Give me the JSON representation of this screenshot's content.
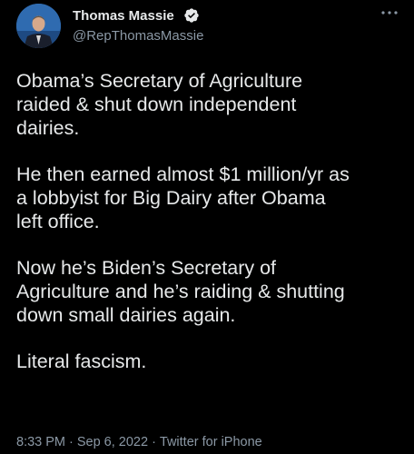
{
  "tweet": {
    "author": {
      "name": "Thomas Massie",
      "handle": "@RepThomasMassie",
      "verified": true,
      "avatar_icon": "profile-photo"
    },
    "menu_icon": "more-dots-icon",
    "paragraphs": [
      "Obama’s Secretary of Agriculture\nraided & shut down independent\ndairies.",
      "He then earned almost $1 million/yr as\na lobbyist for Big Dairy after Obama\nleft office.",
      "Now he’s Biden’s Secretary of\nAgriculture and he’s raiding & shutting\ndown small dairies again.",
      "Literal fascism."
    ],
    "time": "8:33 PM",
    "date": "Sep 6, 2022",
    "source": "Twitter for iPhone",
    "separator": "·"
  },
  "colors": {
    "background": "#000000",
    "text_primary": "#e7e9ea",
    "text_secondary": "#8b98a5",
    "verified_badge": "#1d9bf0"
  }
}
